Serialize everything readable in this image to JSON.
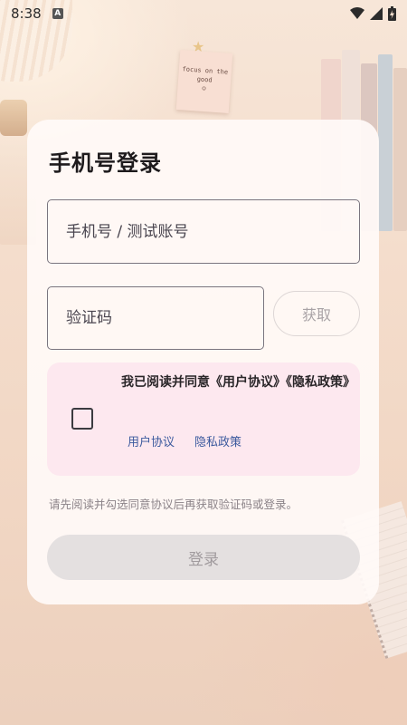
{
  "status_bar": {
    "time": "8:38",
    "notification_icon": "A"
  },
  "background": {
    "note_text": "focus on the good"
  },
  "login": {
    "title": "手机号登录",
    "phone_placeholder": "手机号 / 测试账号",
    "code_placeholder": "验证码",
    "get_code_label": "获取",
    "agreement_text": "我已阅读并同意《用户协议》《隐私政策》",
    "user_agreement_link": "用户协议",
    "privacy_policy_link": "隐私政策",
    "hint": "请先阅读并勾选同意协议后再获取验证码或登录。",
    "login_label": "登录"
  },
  "colors": {
    "card_background": "#fffaf7",
    "agreement_background": "#fde8ef",
    "link_color": "#3c5a9e",
    "disabled_button": "#e4e0e0"
  }
}
